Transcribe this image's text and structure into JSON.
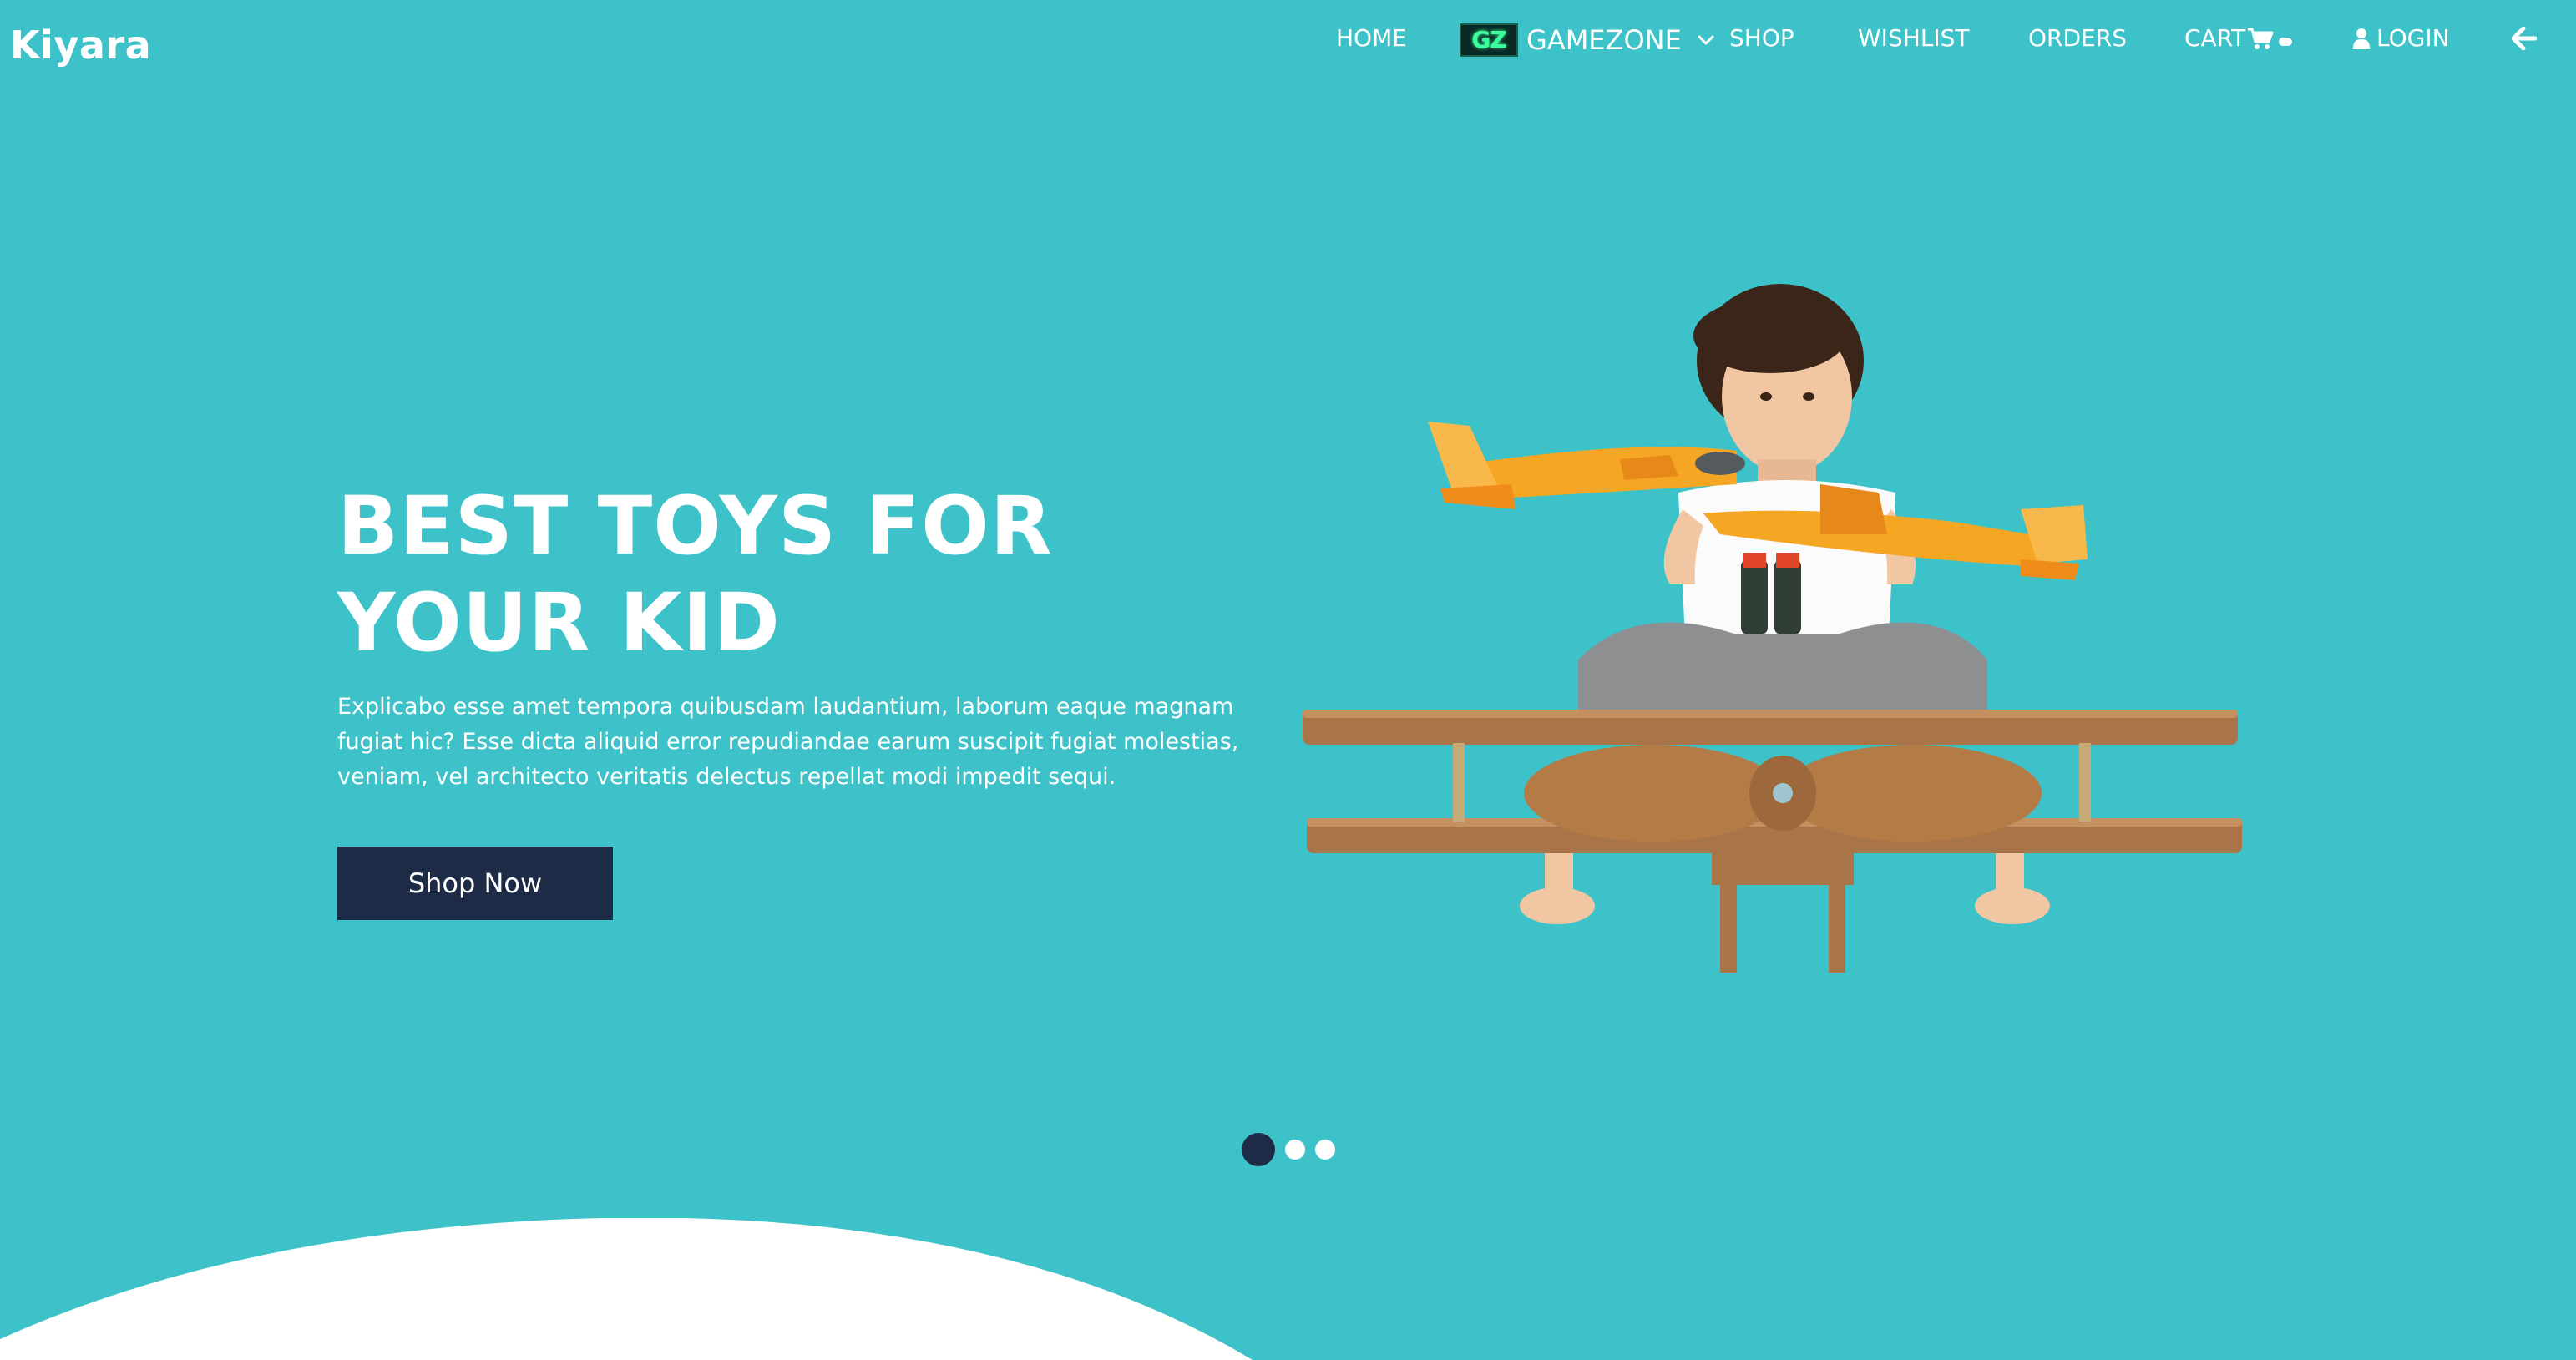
{
  "header": {
    "brand": "Kiyara",
    "nav": {
      "home": "HOME",
      "gamezone_logo": "GZ",
      "gamezone": "GAMEZONE",
      "shop": "SHOP",
      "wishlist": "WISHLIST",
      "orders": "ORDERS",
      "cart": "CART",
      "login": "LOGIN"
    },
    "icons": {
      "gamezone_chevron": "chevron-down-icon",
      "cart": "cart-icon",
      "login": "user-icon",
      "back": "arrow-left-icon"
    }
  },
  "hero": {
    "title_line1": "BEST TOYS FOR",
    "title_line2": "YOUR KID",
    "text": "Explicabo esse amet tempora quibusdam laudantium, laborum eaque magnam fugiat hic? Esse dicta aliquid error repudiandae earum suscipit fugiat molestias, veniam, vel architecto veritatis delectus repellat modi impedit sequi.",
    "button": "Shop Now",
    "image": "child-with-toy-planes-illustration"
  },
  "carousel": {
    "total": 3,
    "active_index": 1
  },
  "colors": {
    "background": "#3cc2c8",
    "accent": "#1e2b47",
    "text": "#ffffff",
    "wave": "#ffffff"
  }
}
